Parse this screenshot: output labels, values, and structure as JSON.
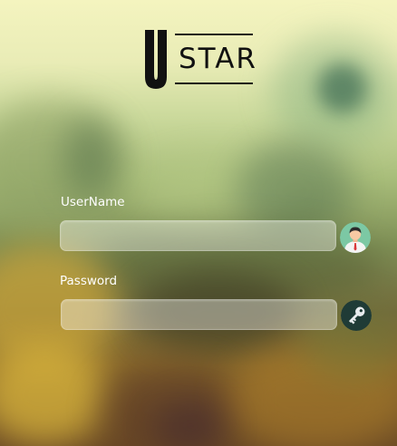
{
  "logo": {
    "letter": "U",
    "text": "STAR"
  },
  "form": {
    "username_label": "UserName",
    "username_value": "",
    "username_placeholder": "",
    "password_label": "Password",
    "password_value": "",
    "password_placeholder": ""
  },
  "icons": {
    "username": "user-avatar-icon",
    "password": "key-icon"
  },
  "colors": {
    "label_text": "#ffffff",
    "logo_text": "#111111",
    "avatar_bg": "#7cc8a4",
    "key_bg": "#1f3b36"
  }
}
